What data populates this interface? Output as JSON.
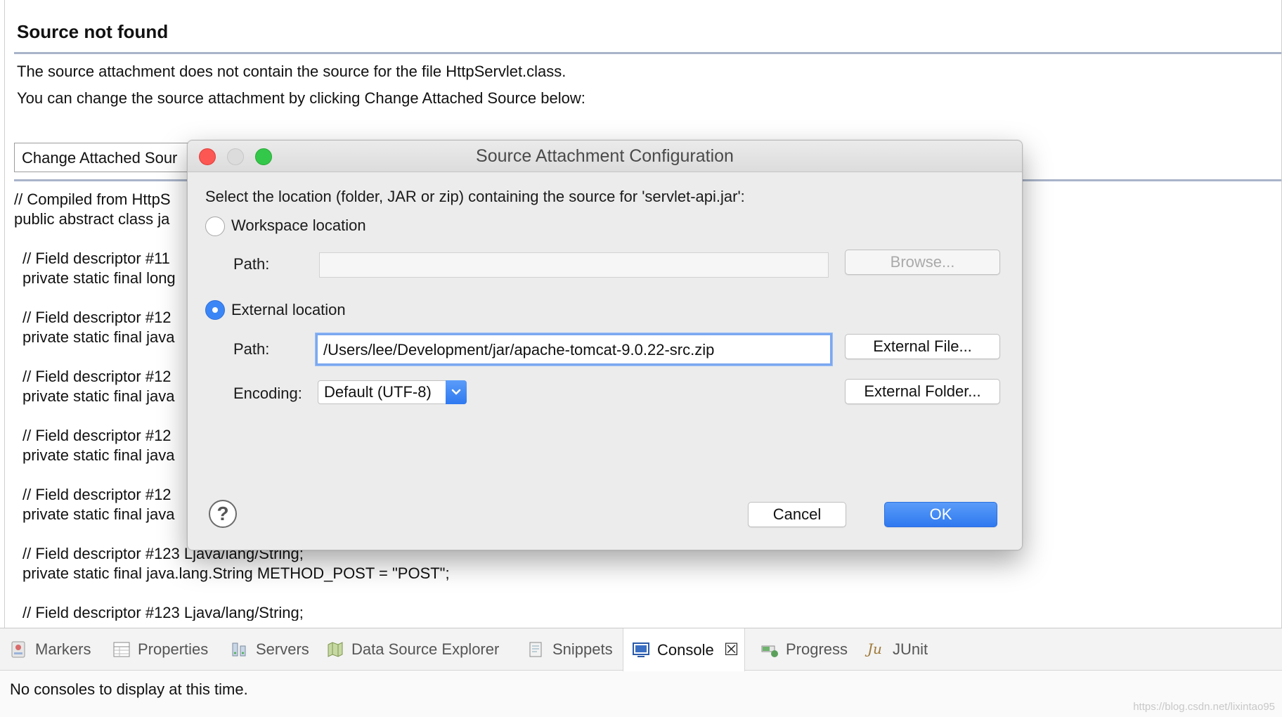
{
  "editor": {
    "title": "Source not found",
    "message_line1": "The source attachment does not contain the source for the file HttpServlet.class.",
    "message_line2": "You can change the source attachment by clicking Change Attached Source below:",
    "change_button_label": "Change Attached Sour",
    "code_lines": [
      "// Compiled from HttpS",
      "public abstract class ja",
      "// Field descriptor #11",
      "private static final long",
      "// Field descriptor #12",
      "private static final java",
      "// Field descriptor #12",
      "private static final java",
      "// Field descriptor #12",
      "private static final java",
      "// Field descriptor #12",
      "private static final java",
      "// Field descriptor #123 Ljava/lang/String;",
      "private static final java.lang.String METHOD_POST = \"POST\";",
      "// Field descriptor #123 Ljava/lang/String;"
    ]
  },
  "dialog": {
    "title": "Source Attachment Configuration",
    "prompt": "Select the location (folder, JAR or zip) containing the source for 'servlet-api.jar':",
    "workspace": {
      "label": "Workspace location",
      "selected": false,
      "path_label": "Path:",
      "path_value": "",
      "browse_label": "Browse..."
    },
    "external": {
      "label": "External location",
      "selected": true,
      "path_label": "Path:",
      "path_value": "/Users/lee/Development/jar/apache-tomcat-9.0.22-src.zip",
      "external_file_label": "External File...",
      "encoding_label": "Encoding:",
      "encoding_value": "Default (UTF-8)",
      "external_folder_label": "External Folder..."
    },
    "help_label": "?",
    "cancel_label": "Cancel",
    "ok_label": "OK"
  },
  "bottom_panel": {
    "tabs": [
      {
        "label": "Markers",
        "icon": "markers-icon"
      },
      {
        "label": "Properties",
        "icon": "properties-icon"
      },
      {
        "label": "Servers",
        "icon": "servers-icon"
      },
      {
        "label": "Data Source Explorer",
        "icon": "data-source-icon"
      },
      {
        "label": "Snippets",
        "icon": "snippets-icon"
      },
      {
        "label": "Console",
        "icon": "console-icon",
        "active": true
      },
      {
        "label": "Progress",
        "icon": "progress-icon"
      },
      {
        "label": "JUnit",
        "icon": "junit-icon"
      }
    ],
    "close_glyph": "☒",
    "empty_message": "No consoles to display at this time.",
    "watermark": "https://blog.csdn.net/lixintao95"
  },
  "colors": {
    "ok_button": "#2f79f0",
    "traffic_close": "#fc5753",
    "traffic_max": "#34c84a",
    "rule": "#a9b4c9"
  }
}
